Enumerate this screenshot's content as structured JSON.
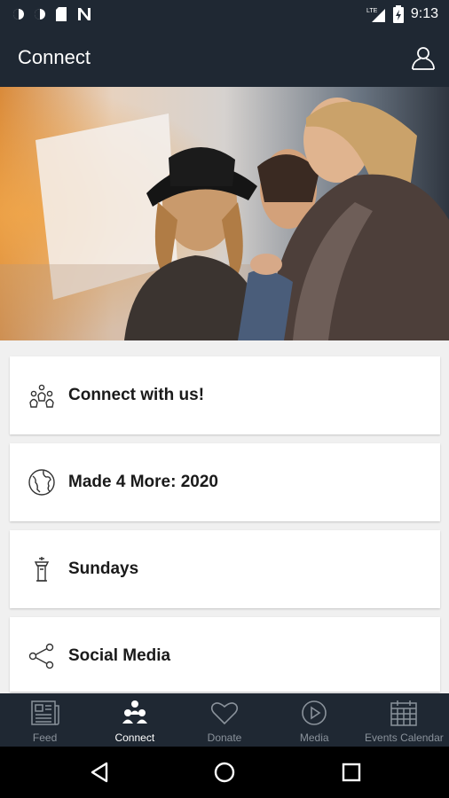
{
  "status_bar": {
    "time": "9:13",
    "network": "LTE",
    "icons": [
      "notification-icon",
      "notification-icon",
      "sd-card-icon",
      "n-notification-icon",
      "lte-signal-icon",
      "battery-icon"
    ]
  },
  "app_bar": {
    "title": "Connect",
    "profile_icon": "user-icon"
  },
  "hero": {
    "image": "photo of three smiling women"
  },
  "list_items": [
    {
      "label": "Connect with us!",
      "icon": "people-icon"
    },
    {
      "label": "Made 4 More: 2020",
      "icon": "globe-icon"
    },
    {
      "label": "Sundays",
      "icon": "pulpit-icon"
    },
    {
      "label": "Social Media",
      "icon": "share-icon"
    }
  ],
  "bottom_nav": {
    "items": [
      {
        "label": "Feed",
        "icon": "feed-icon",
        "active": false
      },
      {
        "label": "Connect",
        "icon": "connect-icon",
        "active": true
      },
      {
        "label": "Donate",
        "icon": "heart-icon",
        "active": false
      },
      {
        "label": "Media",
        "icon": "play-icon",
        "active": false
      },
      {
        "label": "Events Calendar",
        "icon": "calendar-icon",
        "active": false
      }
    ]
  },
  "system_nav": [
    "back-icon",
    "home-icon",
    "recents-icon"
  ],
  "colors": {
    "header_bg": "#1f2833",
    "active_nav": "#ffffff",
    "inactive_nav": "#8a929b"
  }
}
